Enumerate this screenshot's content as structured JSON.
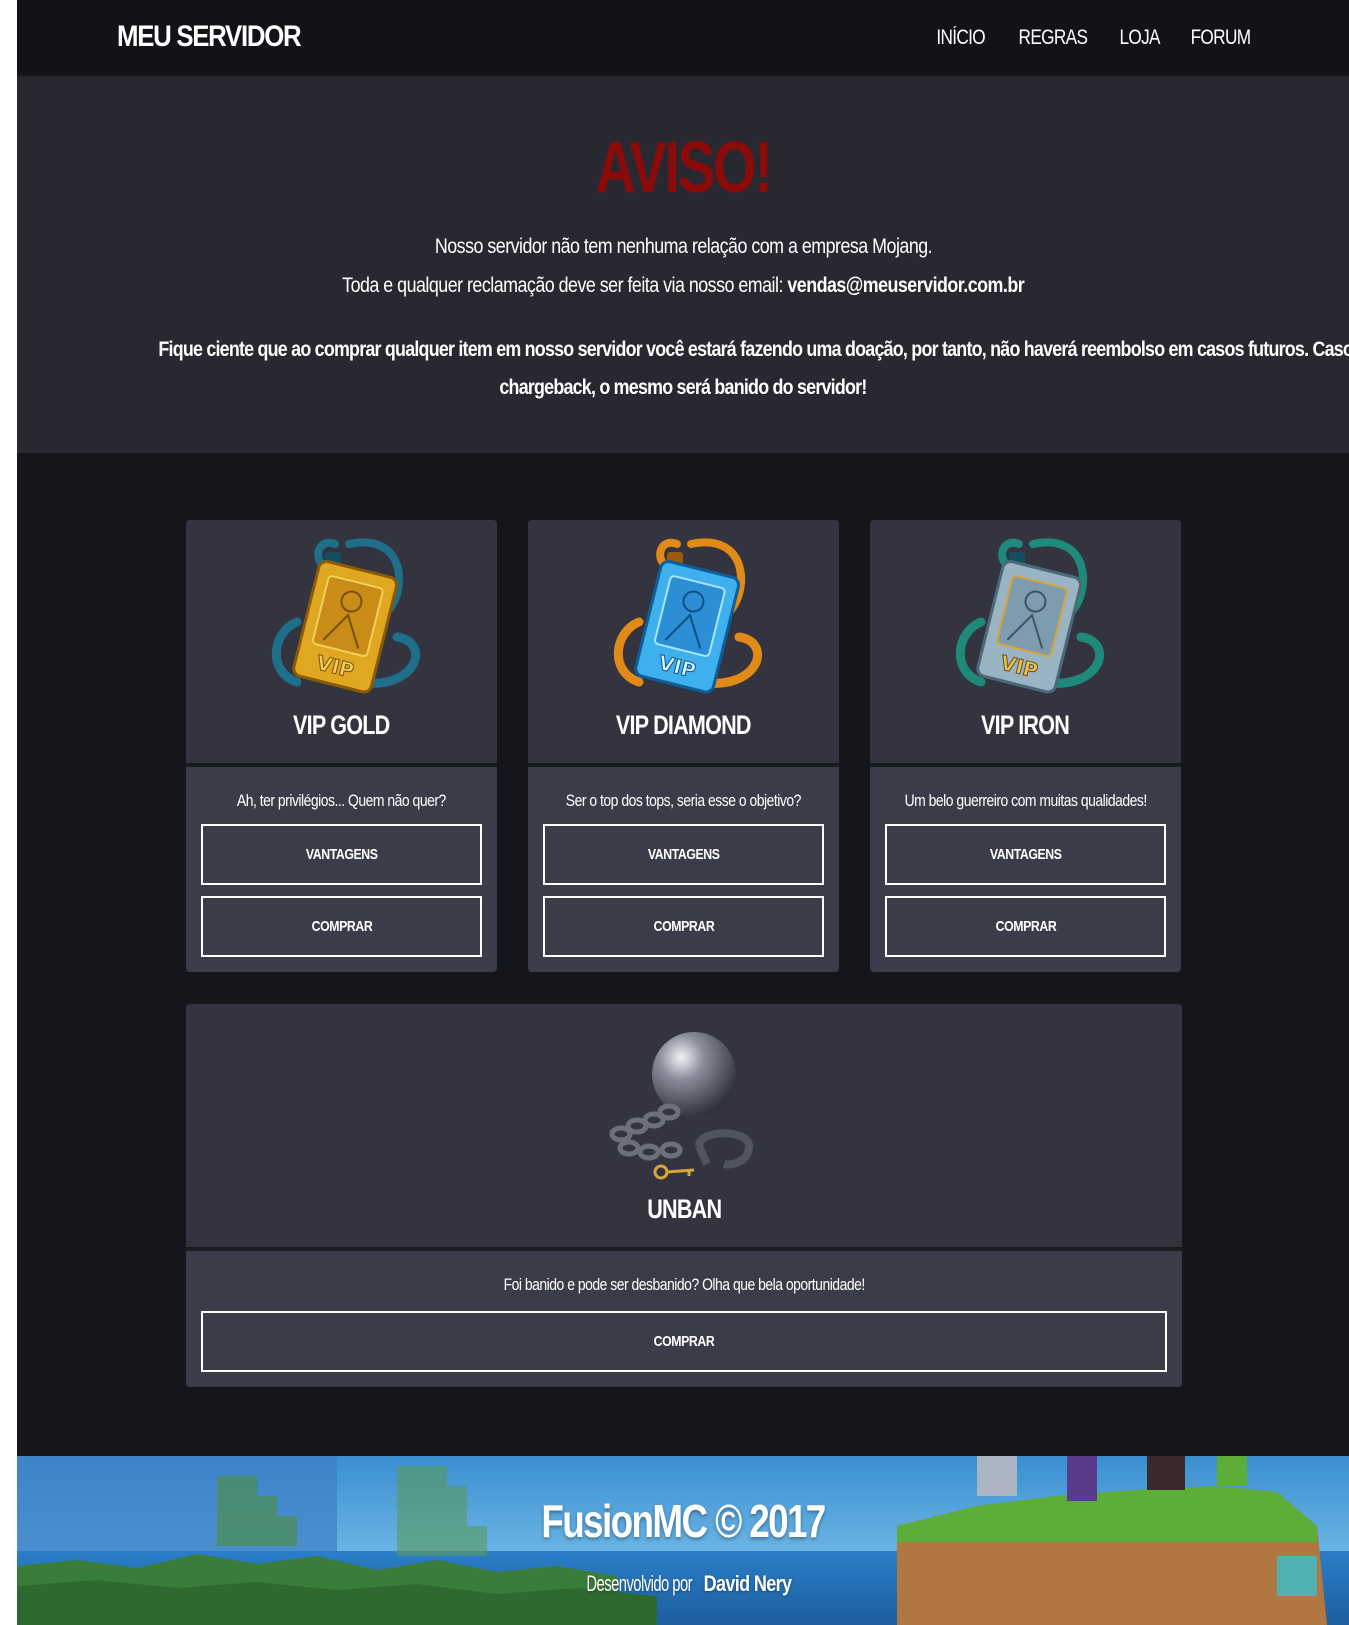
{
  "navbar": {
    "brand": "MEU SERVIDOR",
    "links": [
      "INÍCIO",
      "REGRAS",
      "LOJA",
      "FORUM"
    ]
  },
  "notice": {
    "title": "AVISO!",
    "line1": "Nosso servidor não tem nenhuma relação com a empresa Mojang.",
    "line2_prefix": "Toda e qualquer reclamação deve ser feita via nosso email: ",
    "email": "vendas@meuservidor.com.br",
    "warning_line1": "Fique ciente que ao comprar qualquer item em nosso servidor você estará fazendo uma doação, por tanto, não haverá reembolso em casos futuros. Caso o cliente tente",
    "warning_line2": "chargeback, o mesmo será banido do servidor!"
  },
  "products": [
    {
      "name": "VIP GOLD",
      "description": "Ah, ter privilégios... Quem não quer?",
      "advantages_label": "VANTAGENS",
      "buy_label": "COMPRAR",
      "icon": "vip-gold-badge-icon",
      "card_color": "#e0a820"
    },
    {
      "name": "VIP DIAMOND",
      "description": "Ser o top dos tops, seria esse o objetivo?",
      "advantages_label": "VANTAGENS",
      "buy_label": "COMPRAR",
      "icon": "vip-diamond-badge-icon",
      "card_color": "#3fb0ee"
    },
    {
      "name": "VIP IRON",
      "description": "Um belo guerreiro com muitas qualidades!",
      "advantages_label": "VANTAGENS",
      "buy_label": "COMPRAR",
      "icon": "vip-iron-badge-icon",
      "card_color": "#9ab4c4"
    }
  ],
  "unban": {
    "name": "UNBAN",
    "description": "Foi banido e pode ser desbanido? Olha que bela oportunidade!",
    "buy_label": "COMPRAR",
    "icon": "ball-and-chain-icon"
  },
  "footer": {
    "title": "FusionMC © 2017",
    "sub_prefix": "Desenvolvido por ",
    "author": "David Nery"
  },
  "colors": {
    "page_bg": "#15161b",
    "navbar_bg": "#121317",
    "notice_bg": "#272830",
    "notice_title": "#8b0a0a",
    "card_head_bg": "#33343f",
    "card_body_bg": "#3b3c4a"
  }
}
